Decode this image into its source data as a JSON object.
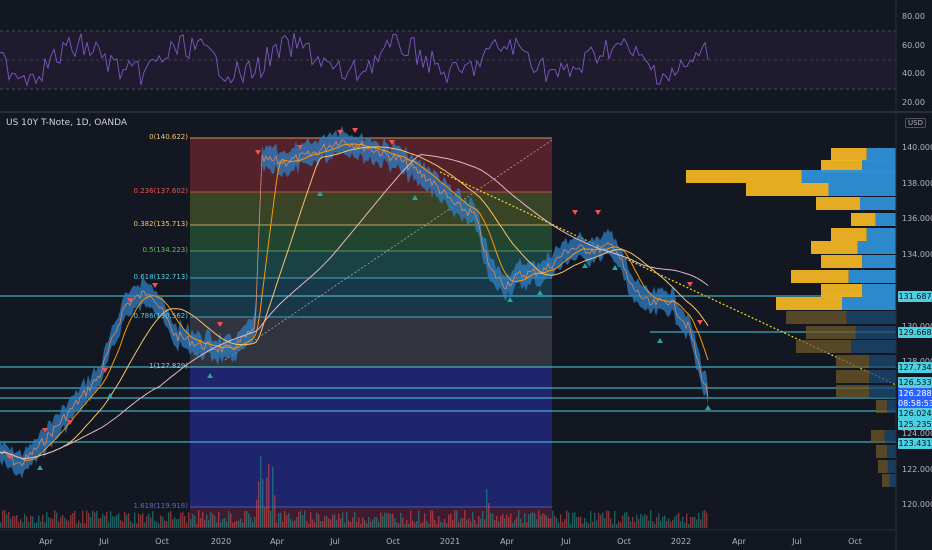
{
  "header": {
    "symbol": "US 10Y T-Note, 1D, OANDA",
    "currency": "USD"
  },
  "rsi_axis": [
    "80.00",
    "60.00",
    "40.00",
    "20.00"
  ],
  "price_axis": [
    "140.000",
    "138.000",
    "136.000",
    "134.000",
    "130.000",
    "128.000",
    "124.000",
    "122.000",
    "120.000"
  ],
  "price_tags": [
    {
      "label": "131.687",
      "color": "#4dd0e1"
    },
    {
      "label": "129.668",
      "color": "#4dd0e1"
    },
    {
      "label": "127.734",
      "color": "#4dd0e1"
    },
    {
      "label": "126.533",
      "color": "#4dd0e1"
    },
    {
      "label": "126.288",
      "color": "#2962ff"
    },
    {
      "label": "08:58:53",
      "color": "#2962ff"
    },
    {
      "label": "126.024",
      "color": "#4dd0e1"
    },
    {
      "label": "125.235",
      "color": "#4dd0e1"
    },
    {
      "label": "123.431",
      "color": "#4dd0e1"
    }
  ],
  "fib_levels": [
    {
      "label": "0(140.622)",
      "color": "#f7c46c"
    },
    {
      "label": "0.236(137.602)",
      "color": "#ef5350"
    },
    {
      "label": "0.382(135.713)",
      "color": "#f7c46c"
    },
    {
      "label": "0.5(134.223)",
      "color": "#66bb6a"
    },
    {
      "label": "0.618(132.713)",
      "color": "#4dd0e1"
    },
    {
      "label": "0.786(130.562)",
      "color": "#4dd0e1"
    },
    {
      "label": "1(127.829)",
      "color": "#b2b5be"
    },
    {
      "label": "1.618(119.918)",
      "color": "#5c6bc0"
    }
  ],
  "time_axis": [
    "Apr",
    "Jul",
    "Oct",
    "2020",
    "Apr",
    "Jul",
    "Oct",
    "2021",
    "Apr",
    "Jul",
    "Oct",
    "2022",
    "Apr",
    "Jul",
    "Oct"
  ],
  "colors": {
    "accent": "#2962ff",
    "up": "#26a69a",
    "down": "#ef5350",
    "rsi": "#7e57c2"
  }
}
